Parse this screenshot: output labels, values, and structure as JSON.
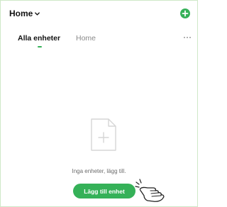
{
  "header": {
    "title": "Home",
    "dropdown_icon": "chevron-down-icon",
    "add_icon": "plus-circle-icon"
  },
  "tabs": [
    {
      "label": "Alla enheter",
      "active": true
    },
    {
      "label": "Home",
      "active": false
    }
  ],
  "more_label": "···",
  "empty_state": {
    "icon": "file-add-icon",
    "message": "Inga enheter, lägg till."
  },
  "add_button": {
    "label": "Lägg till enhet"
  },
  "pointer_icon": "hand-pointer-icon",
  "colors": {
    "accent": "#35b158",
    "border": "#cfe8c8",
    "muted_text": "#8a8a8a"
  }
}
